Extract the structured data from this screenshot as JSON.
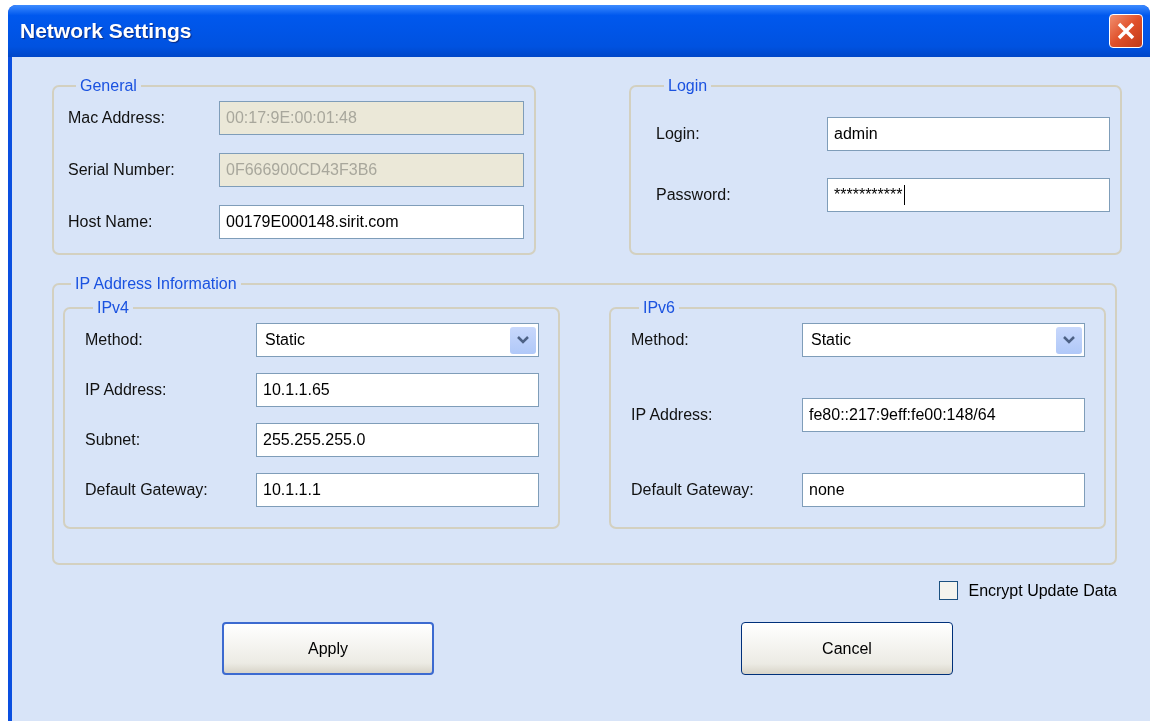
{
  "window": {
    "title": "Network Settings"
  },
  "general": {
    "title": "General",
    "fields": [
      {
        "label": "Mac Address:",
        "value": "00:17:9E:00:01:48",
        "disabled": true
      },
      {
        "label": "Serial Number:",
        "value": "0F666900CD43F3B6",
        "disabled": true
      },
      {
        "label": "Host Name:",
        "value": "00179E000148.sirit.com",
        "disabled": false
      }
    ]
  },
  "login": {
    "title": "Login",
    "fields": [
      {
        "label": "Login:",
        "value": "admin",
        "focused": false
      },
      {
        "label": "Password:",
        "value": "***********",
        "focused": true
      }
    ]
  },
  "ip_info": {
    "title": "IP Address Information",
    "groups": [
      {
        "title": "IPv4",
        "rows": [
          {
            "kind": "select",
            "label": "Method:",
            "value": "Static"
          },
          {
            "kind": "text",
            "label": "IP Address:",
            "value": "10.1.1.65"
          },
          {
            "kind": "text",
            "label": "Subnet:",
            "value": "255.255.255.0"
          },
          {
            "kind": "text",
            "label": "Default Gateway:",
            "value": "10.1.1.1"
          }
        ]
      },
      {
        "title": "IPv6",
        "rows": [
          {
            "kind": "select",
            "label": "Method:",
            "value": "Static"
          },
          {
            "kind": "text",
            "label": "IP Address:",
            "value": "fe80::217:9eff:fe00:148/64"
          },
          {
            "kind": "text",
            "label": "Default Gateway:",
            "value": "none"
          }
        ]
      }
    ]
  },
  "encrypt": {
    "label": "Encrypt Update Data",
    "checked": false
  },
  "buttons": [
    {
      "label": "Apply",
      "default": true
    },
    {
      "label": "Cancel",
      "default": false
    }
  ]
}
